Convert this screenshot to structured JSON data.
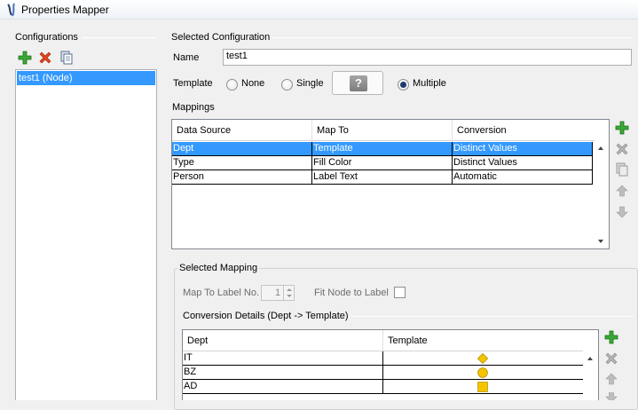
{
  "window": {
    "title": "Properties Mapper",
    "icon": "tree-mapper-icon"
  },
  "configurations": {
    "heading": "Configurations",
    "toolbar": {
      "add_icon": "add-plus-icon",
      "delete_icon": "delete-x-icon",
      "copy_icon": "copy-icon"
    },
    "items": [
      {
        "label": "test1 (Node)",
        "selected": true
      }
    ]
  },
  "selected_configuration": {
    "heading": "Selected Configuration",
    "name_label": "Name",
    "name_value": "test1",
    "template_label": "Template",
    "template_options": [
      {
        "label": "None",
        "checked": false
      },
      {
        "label": "Single",
        "checked": false
      },
      {
        "label": "Multiple",
        "checked": true
      }
    ],
    "template_button_icon": "question-mark-icon"
  },
  "mappings": {
    "heading": "Mappings",
    "columns": [
      "Data Source",
      "Map To",
      "Conversion"
    ],
    "rows": [
      {
        "source": "Dept",
        "map_to": "Template",
        "conversion": "Distinct Values",
        "selected": true
      },
      {
        "source": "Type",
        "map_to": "Fill Color",
        "conversion": "Distinct Values",
        "selected": false
      },
      {
        "source": "Person",
        "map_to": "Label Text",
        "conversion": "Automatic",
        "selected": false
      }
    ],
    "side_icons": [
      "add-plus-icon",
      "delete-x-icon",
      "copy-icon",
      "arrow-up-icon",
      "arrow-down-icon"
    ]
  },
  "selected_mapping": {
    "heading": "Selected Mapping",
    "label_no_label": "Map To Label No.",
    "label_no_value": "1",
    "fit_node_label": "Fit Node to Label",
    "fit_node_checked": false,
    "conversion_heading": "Conversion Details (Dept -> Template)",
    "columns": [
      "Dept",
      "Template"
    ],
    "rows": [
      {
        "dept": "IT",
        "shape": "diamond"
      },
      {
        "dept": "BZ",
        "shape": "circle"
      },
      {
        "dept": "AD",
        "shape": "square"
      }
    ],
    "shape_color": "#f5c400",
    "side_icons": [
      "add-plus-icon",
      "delete-x-icon",
      "arrow-up-icon",
      "arrow-down-icon"
    ]
  },
  "colors": {
    "selection": "#3399ff",
    "add": "#2e9d2e",
    "delete": "#d83a1c"
  }
}
